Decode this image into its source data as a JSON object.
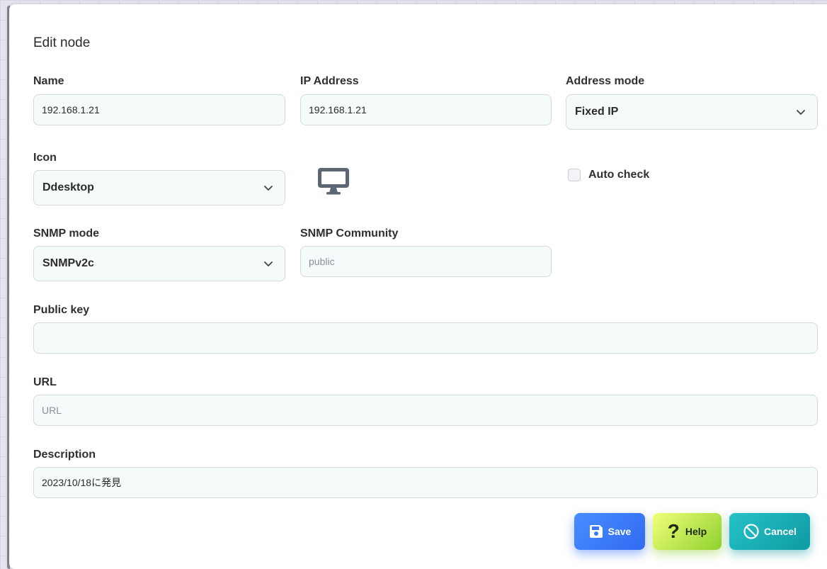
{
  "dialog": {
    "title": "Edit node"
  },
  "form": {
    "name": {
      "label": "Name",
      "value": "192.168.1.21"
    },
    "ip_address": {
      "label": "IP Address",
      "value": "192.168.1.21"
    },
    "address_mode": {
      "label": "Address mode",
      "selected": "Fixed IP"
    },
    "icon": {
      "label": "Icon",
      "selected": "Ddesktop",
      "preview_icon": "desktop-monitor-icon"
    },
    "auto_check": {
      "label": "Auto check",
      "checked": false
    },
    "snmp_mode": {
      "label": "SNMP mode",
      "selected": "SNMPv2c"
    },
    "snmp_community": {
      "label": "SNMP Community",
      "value": "",
      "placeholder": "public"
    },
    "public_key": {
      "label": "Public key",
      "value": ""
    },
    "url": {
      "label": "URL",
      "value": "",
      "placeholder": "URL"
    },
    "description": {
      "label": "Description",
      "value": "2023/10/18に発見"
    }
  },
  "buttons": {
    "save": {
      "label": "Save",
      "icon": "floppy-disk-icon",
      "color": "#2f6bf2"
    },
    "help": {
      "label": "Help",
      "icon": "question-mark-icon",
      "color": "#8ed12e"
    },
    "cancel": {
      "label": "Cancel",
      "icon": "ban-circle-icon",
      "color": "#0f9aa2"
    }
  }
}
